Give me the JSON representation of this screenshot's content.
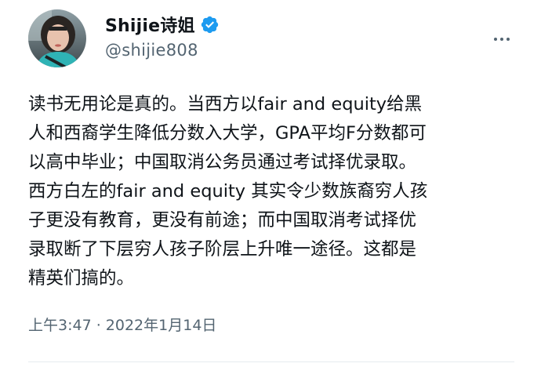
{
  "author": {
    "display_name": "Shijie诗姐",
    "handle": "@shijie808",
    "verified": true,
    "verified_color": "#1d9bf0",
    "avatar_icon": "profile-photo"
  },
  "actions": {
    "more_icon": "more-horizontal-icon"
  },
  "tweet": {
    "lines": [
      "读书无用论是真的。当西方以fair and equity给黑",
      "人和西裔学生降低分数入大学，GPA平均F分数都可",
      "以高中毕业；中国取消公务员通过考试择优录取。",
      "西方白左的fair and equity 其实令少数族裔穷人孩",
      "子更没有教育，更没有前途；而中国取消考试择优",
      "录取断了下层穷人孩子阶层上升唯一途径。这都是",
      "精英们搞的。"
    ],
    "timestamp": "上午3:47 · 2022年1月14日"
  },
  "colors": {
    "text": "#0f1419",
    "secondary_text": "#536471",
    "divider": "#e6ecf0"
  }
}
